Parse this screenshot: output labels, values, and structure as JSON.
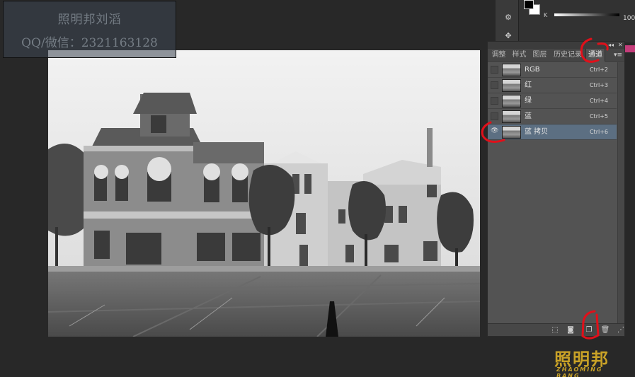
{
  "watermark": {
    "line1": "照明邦刘滔",
    "line2": "QQ/微信：2321163128"
  },
  "color_panel": {
    "k_label": "K",
    "k_value": "100",
    "fg_color": "#000000",
    "bg_color": "#ffffff"
  },
  "panel": {
    "collapse_glyph": "◂◂",
    "close_glyph": "✕",
    "tabs": [
      {
        "label": "调整",
        "active": false
      },
      {
        "label": "样式",
        "active": false
      },
      {
        "label": "图层",
        "active": false
      },
      {
        "label": "历史记录",
        "active": false
      },
      {
        "label": "通道",
        "active": true
      }
    ],
    "menu_glyph": "▾≡",
    "channels": [
      {
        "name": "RGB",
        "shortcut": "Ctrl+2",
        "visible": false,
        "selected": false
      },
      {
        "name": "红",
        "shortcut": "Ctrl+3",
        "visible": false,
        "selected": false
      },
      {
        "name": "绿",
        "shortcut": "Ctrl+4",
        "visible": false,
        "selected": false
      },
      {
        "name": "蓝",
        "shortcut": "Ctrl+5",
        "visible": false,
        "selected": false
      },
      {
        "name": "蓝 拷贝",
        "shortcut": "Ctrl+6",
        "visible": true,
        "selected": true
      }
    ],
    "eye_glyph": "👁",
    "footer_icons": [
      "load-selection-icon",
      "save-selection-icon",
      "new-channel-icon",
      "delete-channel-icon"
    ]
  },
  "logo": {
    "chinese": "照明邦",
    "english": "ZHAOMING BANG",
    "color": "#c9a227"
  },
  "annotation_color": "#e0101a"
}
